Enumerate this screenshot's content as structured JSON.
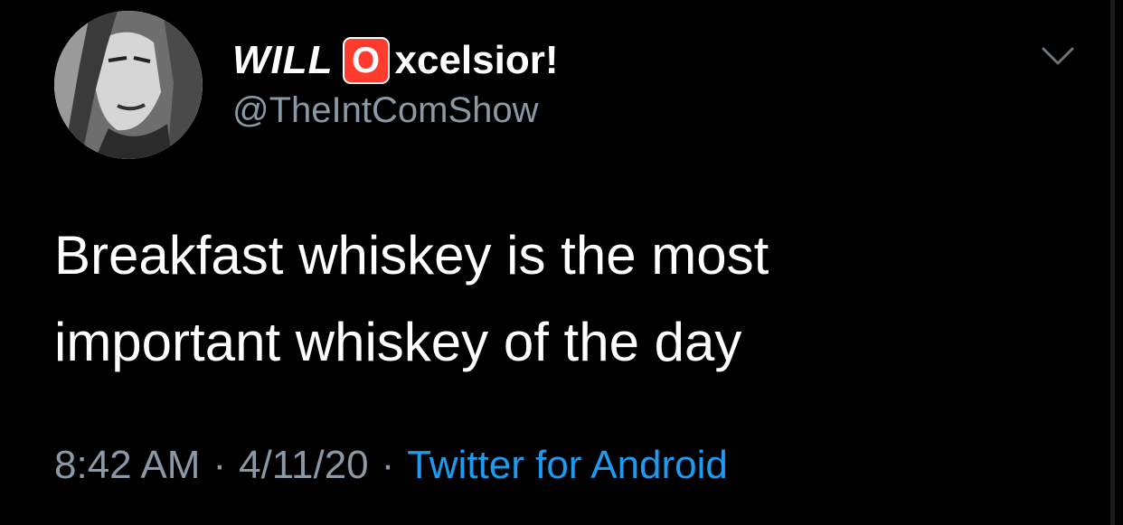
{
  "tweet": {
    "display_name_prefix": "WILL",
    "display_name_badge": "O",
    "display_name_suffix": "xcelsior!",
    "handle": "@TheIntComShow",
    "text_line1": "Breakfast whiskey is the most",
    "text_line2": "important whiskey of the day",
    "time": "8:42 AM",
    "separator": "·",
    "date": "4/11/20",
    "source": "Twitter for Android"
  },
  "icons": {
    "menu": "chevron-down-icon",
    "badge": "red-o-emoji-icon"
  },
  "colors": {
    "background": "#000000",
    "text": "#ffffff",
    "secondary": "#8b98a5",
    "accent": "#1d9bf0",
    "badge": "#ff3b30"
  }
}
